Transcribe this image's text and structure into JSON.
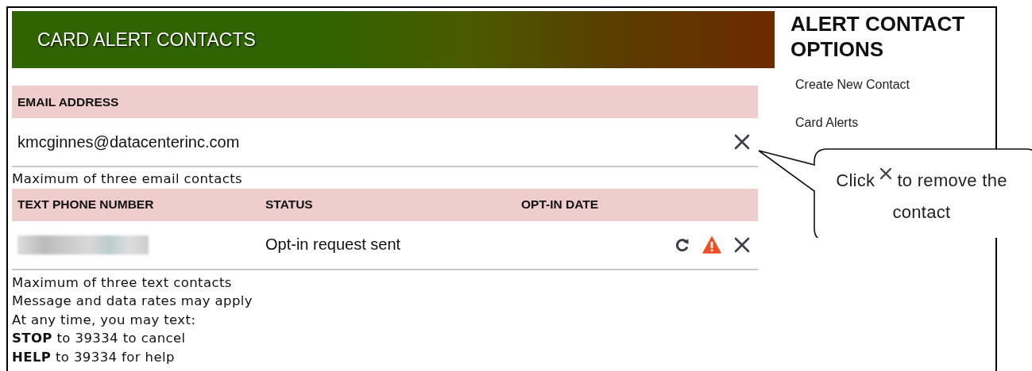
{
  "header": {
    "title": "CARD ALERT CONTACTS"
  },
  "email_table": {
    "columns": [
      "EMAIL ADDRESS"
    ],
    "rows": [
      {
        "email": "kmcginnes@datacenterinc.com",
        "actions": [
          {
            "kind": "remove"
          }
        ]
      }
    ],
    "note": "Maximum of three email contacts"
  },
  "text_table": {
    "columns": [
      "TEXT PHONE NUMBER",
      "STATUS",
      "OPT-IN DATE"
    ],
    "rows": [
      {
        "status": "Opt-in request sent",
        "actions": [
          {
            "kind": "resend"
          },
          {
            "kind": "warning"
          },
          {
            "kind": "remove"
          }
        ]
      }
    ],
    "notes": [
      "Maximum of three text contacts",
      "Message and data rates may apply",
      "At any time, you may text:",
      "**STOP** to 39334 to cancel",
      "**HELP** to 39334 for help"
    ]
  },
  "sidebar": {
    "title": "ALERT CONTACT OPTIONS",
    "links": [
      "Create New Contact",
      "Card Alerts"
    ]
  },
  "callout": {
    "before": "Click",
    "after": "to remove the contact"
  }
}
